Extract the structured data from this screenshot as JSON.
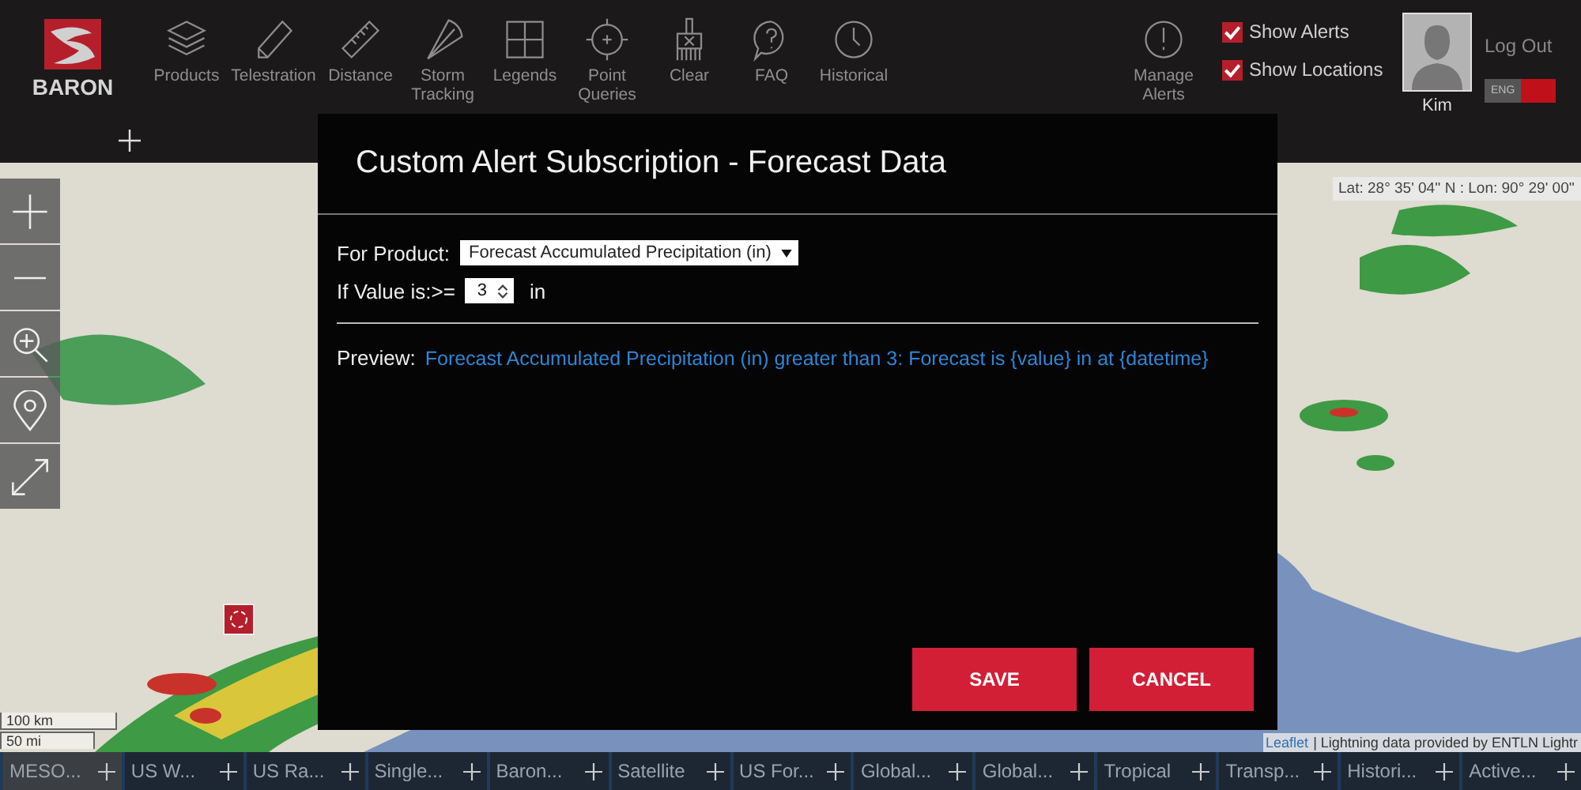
{
  "header": {
    "logo": "BARON",
    "tools": [
      {
        "label": "Products"
      },
      {
        "label": "Telestration"
      },
      {
        "label": "Distance"
      },
      {
        "label": "Storm Tracking"
      },
      {
        "label": "Legends"
      },
      {
        "label": "Point Queries"
      },
      {
        "label": "Clear"
      },
      {
        "label": "FAQ"
      },
      {
        "label": "Historical"
      }
    ],
    "manage_alerts": "Manage Alerts",
    "toggles": [
      {
        "label": "Show Alerts",
        "checked": true
      },
      {
        "label": "Show Locations",
        "checked": true
      }
    ],
    "user": {
      "name": "Kim",
      "logout": "Log Out",
      "language": "ENG",
      "language_switch_on": true
    }
  },
  "map": {
    "coordinates": "Lat: 28° 35' 04'' N : Lon: 90° 29' 00''",
    "scale": [
      "100 km",
      "50 mi"
    ],
    "attribution_link": "Leaflet",
    "attribution": "| Lightning data provided by ENTLN Lightr"
  },
  "modal": {
    "title": "Custom Alert Subscription - Forecast Data",
    "product_label": "For Product:",
    "product_value": "Forecast Accumulated Precipitation (in)",
    "threshold_label": "If Value is:>=",
    "threshold_value": "3",
    "threshold_unit": "in",
    "preview_label": "Preview:",
    "preview_text": "Forecast Accumulated Precipitation (in) greater than 3: Forecast is {value} in at {datetime}",
    "buttons": [
      "SAVE",
      "CANCEL"
    ]
  },
  "tabs": [
    {
      "label": "MESO...",
      "selected": true
    },
    {
      "label": "US W...",
      "selected": false
    },
    {
      "label": "US Ra...",
      "selected": false
    },
    {
      "label": "Single...",
      "selected": false
    },
    {
      "label": "Baron...",
      "selected": false
    },
    {
      "label": "Satellite",
      "selected": false
    },
    {
      "label": "US For...",
      "selected": false
    },
    {
      "label": "Global...",
      "selected": false
    },
    {
      "label": "Global...",
      "selected": false
    },
    {
      "label": "Tropical",
      "selected": false
    },
    {
      "label": "Transp...",
      "selected": false
    },
    {
      "label": "Histori...",
      "selected": false
    },
    {
      "label": "Active...",
      "selected": false
    }
  ]
}
